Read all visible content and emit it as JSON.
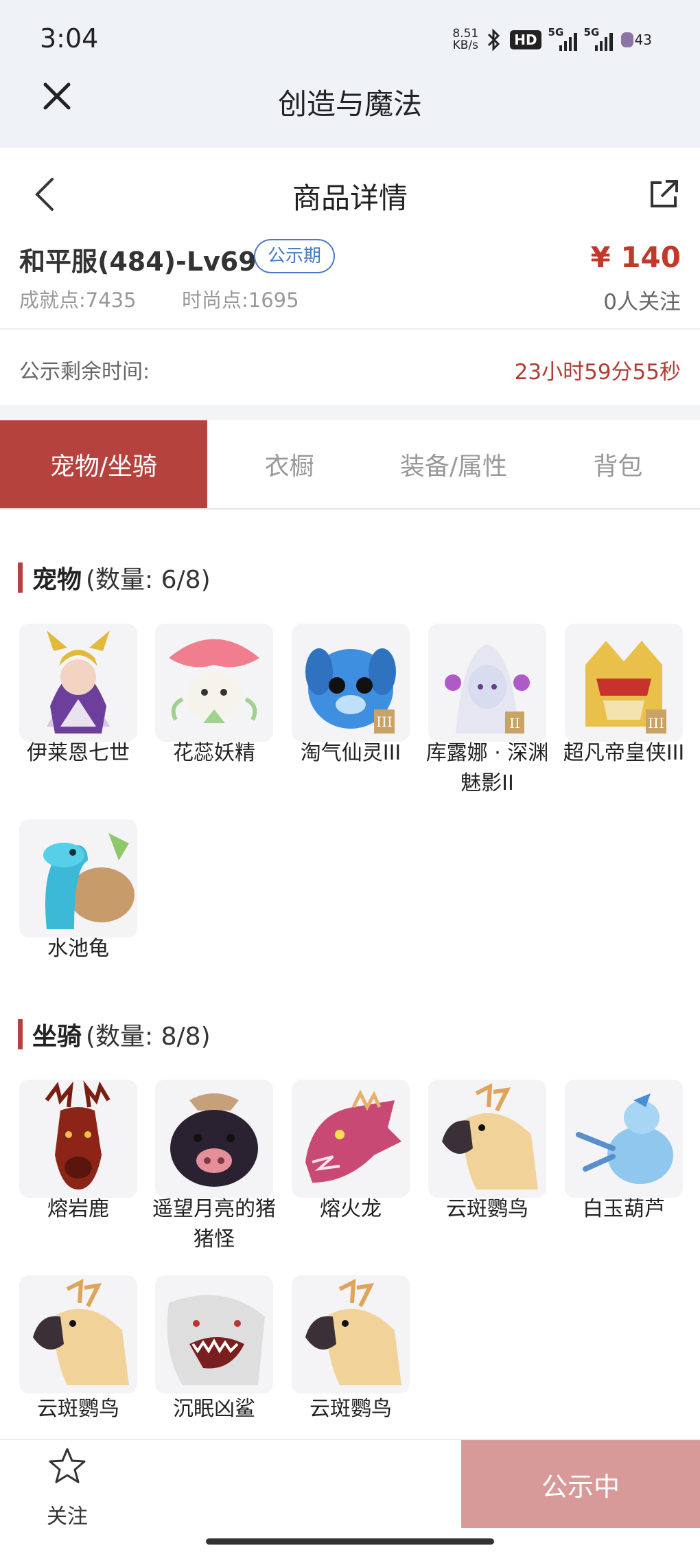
{
  "status_bar": {
    "time": "3:04",
    "net_speed_value": "8.51",
    "net_speed_unit": "KB/s",
    "hd_label": "HD",
    "sim1_label": "5G",
    "sim2_label": "5G",
    "battery": "43"
  },
  "mini_app": {
    "title": "创造与魔法",
    "close_icon": "close-icon"
  },
  "page": {
    "title": "商品详情",
    "back_icon": "chevron-left-icon",
    "share_icon": "share-icon"
  },
  "item": {
    "name": "和平服(484)-Lv69",
    "status_tag": "公示期",
    "price": "¥ 140",
    "achievement": "成就点:7435",
    "fashion": "时尚点:1695",
    "watchers": "0人关注"
  },
  "timer": {
    "label": "公示剩余时间:",
    "value": "23小时59分55秒"
  },
  "tabs": [
    {
      "label": "宠物/坐骑",
      "active": true
    },
    {
      "label": "衣橱",
      "active": false
    },
    {
      "label": "装备/属性",
      "active": false
    },
    {
      "label": "背包",
      "active": false
    }
  ],
  "pets": {
    "title": "宠物",
    "count": "(数量: 6/8)",
    "items": [
      {
        "name": "伊莱恩七世",
        "icon": "goddess-portrait"
      },
      {
        "name": "花蕊妖精",
        "icon": "flower-sprite"
      },
      {
        "name": "淘气仙灵III",
        "icon": "blue-pup"
      },
      {
        "name": "库露娜 · 深渊魅影II",
        "icon": "white-haired-girl"
      },
      {
        "name": "超凡帝皇侠III",
        "icon": "gold-armor"
      },
      {
        "name": "水池龟",
        "icon": "blue-turtle"
      }
    ]
  },
  "mounts": {
    "title": "坐骑",
    "count": "(数量: 8/8)",
    "items": [
      {
        "name": "熔岩鹿",
        "icon": "lava-deer"
      },
      {
        "name": "遥望月亮的猪猪怪",
        "icon": "black-pig"
      },
      {
        "name": "熔火龙",
        "icon": "pink-dragon"
      },
      {
        "name": "云斑鹦鸟",
        "icon": "cockatoo"
      },
      {
        "name": "白玉葫芦",
        "icon": "jade-gourd"
      },
      {
        "name": "云斑鹦鸟",
        "icon": "cockatoo"
      },
      {
        "name": "沉眠凶鲨",
        "icon": "white-shark"
      },
      {
        "name": "云斑鹦鸟",
        "icon": "cockatoo"
      }
    ]
  },
  "bottom_bar": {
    "favorite_label": "关注",
    "favorite_icon": "star-outline-icon",
    "cta_label": "公示中"
  },
  "colors": {
    "accent": "#b5423d",
    "price": "#c0392b",
    "tag_blue": "#4a78c2",
    "cta_disabled": "#d89a99"
  }
}
